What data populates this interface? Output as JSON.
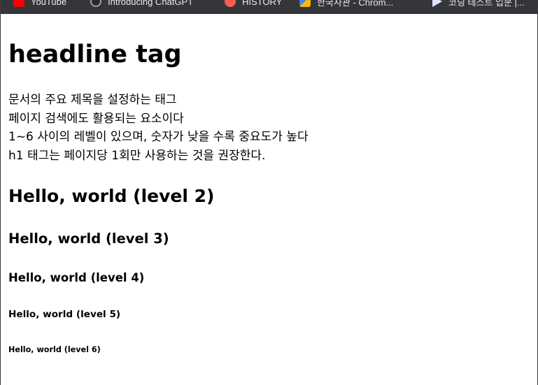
{
  "bookmarks": [
    {
      "label": "YouTube",
      "icon": "youtube-icon"
    },
    {
      "label": "Introducing ChatGPT",
      "icon": "openai-icon"
    },
    {
      "label": "HISTORY",
      "icon": "history-icon"
    },
    {
      "label": "한국사관 - Chrom...",
      "icon": "chrome-app-icon"
    },
    {
      "label": "코딩 테스트 입문 |...",
      "icon": "programmers-icon"
    }
  ],
  "page": {
    "h1": "headline tag",
    "description": [
      "문서의 주요 제목을 설정하는 태그",
      "페이지 검색에도 활용되는 요소이다",
      "1~6 사이의 레벨이 있으며, 숫자가 낮을 수록 중요도가 높다",
      "h1 태그는 페이지당 1회만 사용하는 것을 권장한다."
    ],
    "h2": "Hello, world (level 2)",
    "h3": "Hello, world (level 3)",
    "h4": "Hello, world (level 4)",
    "h5": "Hello, world (level 5)",
    "h6": "Hello, world (level 6)"
  }
}
